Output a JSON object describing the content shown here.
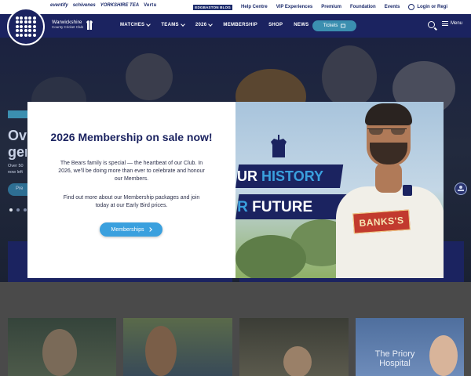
{
  "topbar": {
    "sponsors": [
      "eventify",
      "schivenes",
      "YORKSHIRE TEA",
      "Vertu"
    ],
    "links": [
      {
        "label": "EDGBASTON BLOG",
        "boxed": true
      },
      {
        "label": "Help Centre"
      },
      {
        "label": "VIP Experiences"
      },
      {
        "label": "Premium"
      },
      {
        "label": "Foundation"
      },
      {
        "label": "Events"
      }
    ],
    "login_label": "Login or Regi"
  },
  "header": {
    "club_name": "Warwickshire",
    "club_sub": "County Cricket Club",
    "nav": [
      {
        "label": "MATCHES",
        "dropdown": true
      },
      {
        "label": "TEAMS",
        "dropdown": true
      },
      {
        "label": "2026",
        "dropdown": true
      },
      {
        "label": "MEMBERSHIP",
        "dropdown": false
      },
      {
        "label": "SHOP",
        "dropdown": false
      },
      {
        "label": "NEWS",
        "dropdown": false
      }
    ],
    "tickets_label": "Tickets",
    "menu_label": "Menu"
  },
  "hero": {
    "title_line1": "Ove",
    "title_line2": "gen",
    "copy_line1": "Over 50",
    "copy_line2": "now left",
    "cta_label": "Pre",
    "slide_count": 3,
    "active_slide": 0
  },
  "cards": {
    "priory_text_1": "The Priory",
    "priory_text_2": "Hospital"
  },
  "modal": {
    "title": "2026 Membership on sale now!",
    "paragraph1": "The Bears family is special — the heartbeat of our Club. In 2026, we'll be doing more than ever to celebrate and honour our Members.",
    "paragraph2": "Find out more about our Membership packages and join today at our Early Bird prices.",
    "button_label": "Memberships",
    "close_label": "✕",
    "promo": {
      "banner1_accent": "UR",
      "banner1_text": "HISTORY",
      "banner2_accent": "R",
      "banner2_text": "FUTURE",
      "shirt_sponsor": "BANKS'S"
    }
  },
  "colors": {
    "navy": "#1b2360",
    "accent_blue": "#3aa0de",
    "tickets_blue": "#3b8fb0",
    "sponsor_red": "#c23a2e"
  }
}
